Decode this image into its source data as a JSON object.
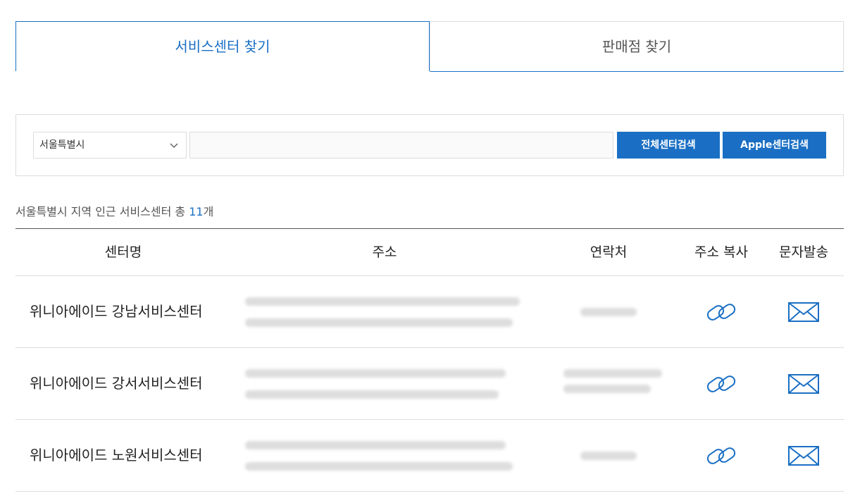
{
  "tabs": {
    "service_center": "서비스센터 찾기",
    "store": "판매점 찾기"
  },
  "search": {
    "region_selected": "서울특별시",
    "keyword_value": "",
    "btn_all": "전체센터검색",
    "btn_apple": "Apple센터검색"
  },
  "summary": {
    "prefix": "서울특별시 지역 인근 서비스센터 총 ",
    "count": "11",
    "suffix": "개"
  },
  "table": {
    "headers": {
      "name": "센터명",
      "address": "주소",
      "contact": "연락처",
      "copy": "주소 복사",
      "sms": "문자발송"
    },
    "rows": [
      {
        "name": "위니아에이드 강남서비스센터"
      },
      {
        "name": "위니아에이드 강서서비스센터"
      },
      {
        "name": "위니아에이드 노원서비스센터"
      }
    ]
  },
  "icons": {
    "copy": "link-icon",
    "sms": "envelope-icon",
    "select": "chevron-down-icon"
  },
  "colors": {
    "accent": "#1a6fc4",
    "border": "#dddddd"
  }
}
